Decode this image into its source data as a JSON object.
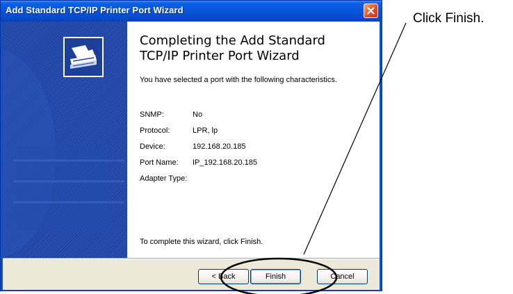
{
  "window": {
    "title": "Add Standard TCP/IP Printer Port Wizard"
  },
  "content": {
    "heading_line1": "Completing the Add Standard",
    "heading_line2": "TCP/IP Printer Port Wizard",
    "intro": "You have selected a port with the following characteristics.",
    "properties": [
      {
        "label": "SNMP:",
        "value": "No"
      },
      {
        "label": "Protocol:",
        "value": "LPR, lp"
      },
      {
        "label": "Device:",
        "value": "192.168.20.185"
      },
      {
        "label": "Port Name:",
        "value": "IP_192.168.20.185"
      },
      {
        "label": "Adapter Type:",
        "value": ""
      }
    ],
    "finish_note": "To complete this wizard, click Finish."
  },
  "buttons": {
    "back": "< Back",
    "finish": "Finish",
    "cancel": "Cancel"
  },
  "annotation": {
    "callout": "Click Finish."
  },
  "icons": [
    "close-icon",
    "wizard-printer-icon"
  ]
}
